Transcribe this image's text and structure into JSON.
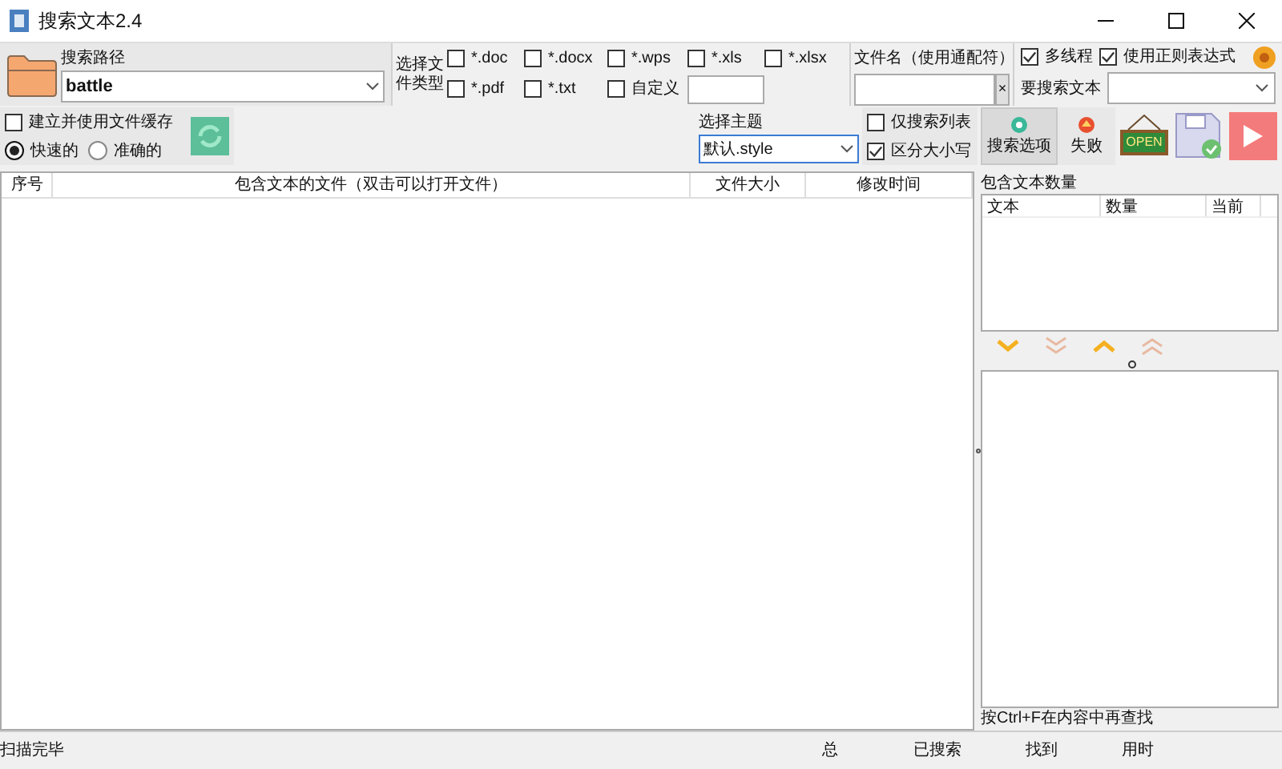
{
  "window": {
    "title": "搜索文本2.4"
  },
  "path": {
    "label": "搜索路径",
    "value": "battle"
  },
  "file_types": {
    "label": "选择文件类型",
    "options": [
      {
        "label": "*.doc",
        "checked": false
      },
      {
        "label": "*.docx",
        "checked": false
      },
      {
        "label": "*.wps",
        "checked": false
      },
      {
        "label": "*.xls",
        "checked": false
      },
      {
        "label": "*.xlsx",
        "checked": false
      },
      {
        "label": "*.pdf",
        "checked": false
      },
      {
        "label": "*.txt",
        "checked": false
      },
      {
        "label": "自定义",
        "checked": false
      }
    ]
  },
  "filename": {
    "label": "文件名（使用通配符）",
    "clear": "×"
  },
  "options": [
    {
      "label": "多线程",
      "checked": true
    },
    {
      "label": "使用正则表达式",
      "checked": true
    }
  ],
  "search_text": {
    "label": "要搜索文本"
  },
  "cache": {
    "label": "建立并使用文件缓存",
    "checked": false,
    "modes": [
      {
        "label": "快速的",
        "selected": true
      },
      {
        "label": "准确的",
        "selected": false
      }
    ]
  },
  "theme": {
    "label": "选择主题",
    "value": "默认.style"
  },
  "filters": [
    {
      "label": "仅搜索列表",
      "checked": false
    },
    {
      "label": "区分大小写",
      "checked": true
    }
  ],
  "tabs": [
    {
      "label": "搜索选项",
      "selected": true
    },
    {
      "label": "失败",
      "selected": false
    }
  ],
  "open_sign": "OPEN",
  "table": {
    "columns": [
      "序号",
      "包含文本的文件（双击可以打开文件）",
      "文件大小",
      "修改时间"
    ]
  },
  "counts": {
    "title": "包含文本数量",
    "columns": [
      "文本",
      "数量",
      "当前"
    ],
    "hint": "按Ctrl+F在内容中再查找"
  },
  "status_bar": [
    "扫描完毕",
    "总",
    "已搜索",
    "找到",
    "用时"
  ]
}
